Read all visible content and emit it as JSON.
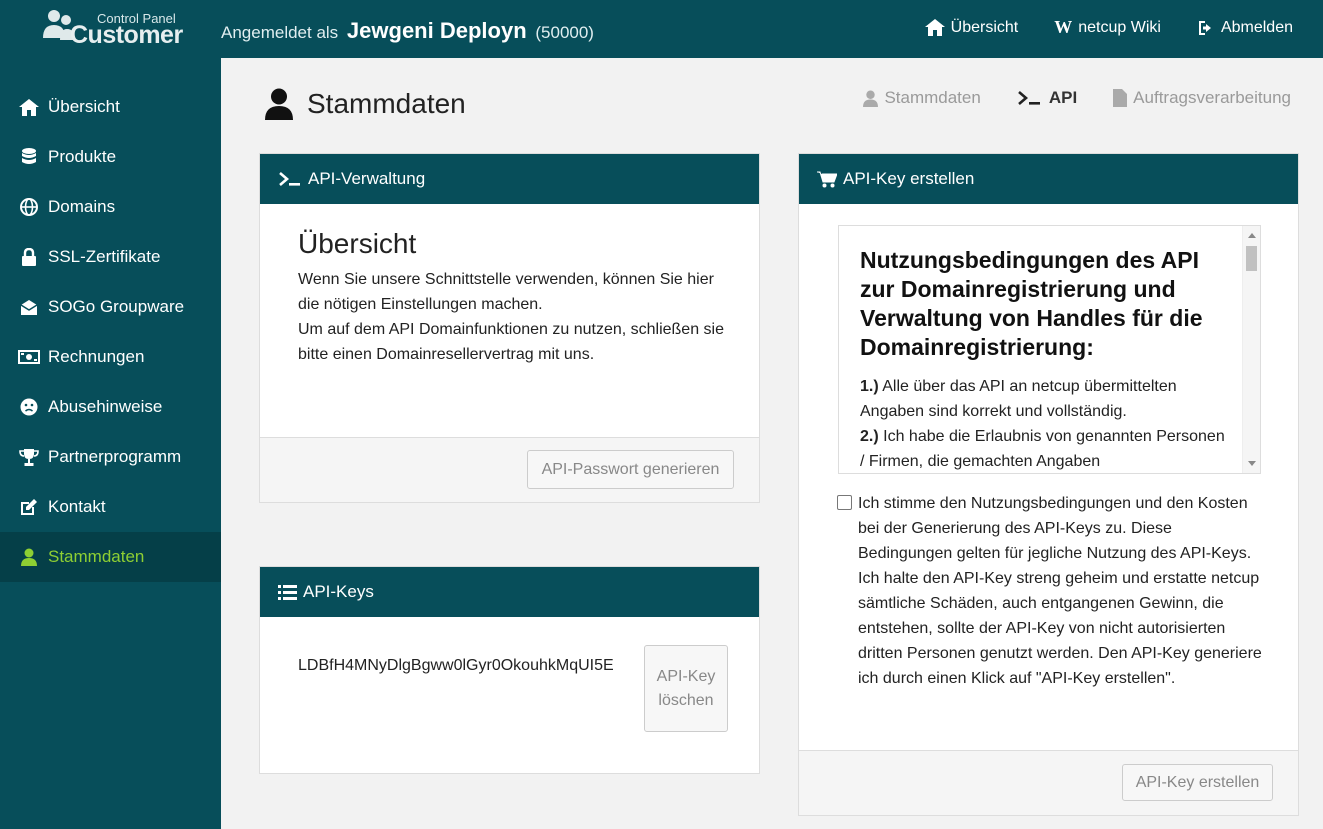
{
  "header": {
    "logo_small": "Control Panel",
    "logo_big": "Customer",
    "login_prefix": "Angemeldet als",
    "user_name": "Jewgeni Deployn",
    "user_id": "(50000)",
    "nav": [
      {
        "label": "Übersicht",
        "icon": "home-icon"
      },
      {
        "label": "netcup Wiki",
        "icon": "wikipedia-w-icon",
        "glyph": "W"
      },
      {
        "label": "Abmelden",
        "icon": "sign-out-icon"
      }
    ]
  },
  "sidebar": {
    "items": [
      {
        "label": "Übersicht",
        "icon": "home-icon"
      },
      {
        "label": "Produkte",
        "icon": "database-icon"
      },
      {
        "label": "Domains",
        "icon": "globe-icon"
      },
      {
        "label": "SSL-Zertifikate",
        "icon": "lock-icon"
      },
      {
        "label": "SOGo Groupware",
        "icon": "envelope-open-icon"
      },
      {
        "label": "Rechnungen",
        "icon": "money-icon"
      },
      {
        "label": "Abusehinweise",
        "icon": "frown-icon"
      },
      {
        "label": "Partnerprogramm",
        "icon": "trophy-icon"
      },
      {
        "label": "Kontakt",
        "icon": "edit-icon"
      },
      {
        "label": "Stammdaten",
        "icon": "user-icon",
        "active": true
      }
    ]
  },
  "page": {
    "title": "Stammdaten",
    "subnav": [
      {
        "label": "Stammdaten",
        "icon": "user-icon"
      },
      {
        "label": "API",
        "icon": "terminal-icon",
        "active": true
      },
      {
        "label": "Auftragsverarbeitung",
        "icon": "file-icon"
      }
    ]
  },
  "api_management": {
    "header": "API-Verwaltung",
    "heading": "Übersicht",
    "text_line1": "Wenn Sie unsere Schnittstelle verwenden, können Sie hier die nötigen Einstellungen machen.",
    "text_line2": "Um auf dem API Domainfunktionen zu nutzen, schließen sie bitte einen Domainresellervertrag mit uns.",
    "button": "API-Passwort generieren"
  },
  "api_keys": {
    "header": "API-Keys",
    "key": "LDBfH4MNyDlgBgww0lGyr0OkouhkMqUI5E",
    "delete_button": "API-Key löschen"
  },
  "create_key": {
    "header": "API-Key erstellen",
    "terms_title": "Nutzungsbedingungen des API zur Domainregistrierung und Verwaltung von Handles für die Domainregistrierung:",
    "term1_num": "1.)",
    "term1_text": "Alle über das API an netcup übermittelten Angaben sind korrekt und vollständig.",
    "term2_num": "2.)",
    "term2_text": "Ich habe die Erlaubnis von genannten Personen / Firmen, die gemachten Angaben",
    "consent_text": "Ich stimme den Nutzungsbedingungen und den Kosten bei der Generierung des API-Keys zu. Diese Bedingungen gelten für jegliche Nutzung des API-Keys. Ich halte den API-Key streng geheim und erstatte netcup sämtliche Schäden, auch entgangenen Gewinn, die entstehen, sollte der API-Key von nicht autorisierten dritten Personen genutzt werden. Den API-Key generiere ich durch einen Klick auf \"API-Key erstellen\".",
    "button": "API-Key erstellen"
  },
  "colors": {
    "brand": "#074e5a",
    "active_sidebar_bg": "#053f48",
    "active_green": "#8ecf33"
  }
}
